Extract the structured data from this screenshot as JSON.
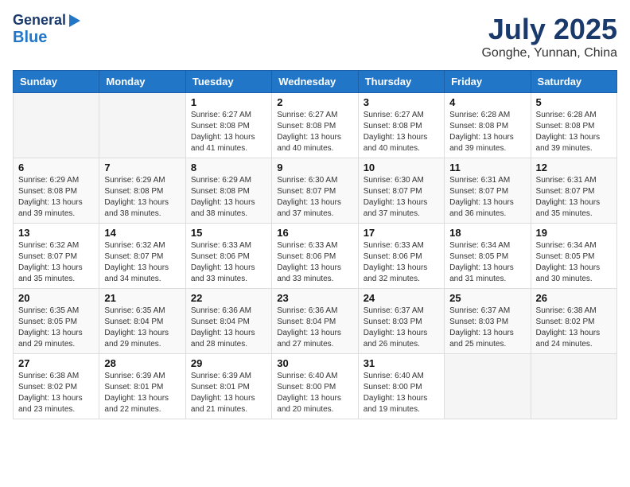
{
  "header": {
    "logo_line1": "General",
    "logo_line2": "Blue",
    "month": "July 2025",
    "location": "Gonghe, Yunnan, China"
  },
  "weekdays": [
    "Sunday",
    "Monday",
    "Tuesday",
    "Wednesday",
    "Thursday",
    "Friday",
    "Saturday"
  ],
  "weeks": [
    [
      {
        "day": "",
        "detail": ""
      },
      {
        "day": "",
        "detail": ""
      },
      {
        "day": "1",
        "detail": "Sunrise: 6:27 AM\nSunset: 8:08 PM\nDaylight: 13 hours and 41 minutes."
      },
      {
        "day": "2",
        "detail": "Sunrise: 6:27 AM\nSunset: 8:08 PM\nDaylight: 13 hours and 40 minutes."
      },
      {
        "day": "3",
        "detail": "Sunrise: 6:27 AM\nSunset: 8:08 PM\nDaylight: 13 hours and 40 minutes."
      },
      {
        "day": "4",
        "detail": "Sunrise: 6:28 AM\nSunset: 8:08 PM\nDaylight: 13 hours and 39 minutes."
      },
      {
        "day": "5",
        "detail": "Sunrise: 6:28 AM\nSunset: 8:08 PM\nDaylight: 13 hours and 39 minutes."
      }
    ],
    [
      {
        "day": "6",
        "detail": "Sunrise: 6:29 AM\nSunset: 8:08 PM\nDaylight: 13 hours and 39 minutes."
      },
      {
        "day": "7",
        "detail": "Sunrise: 6:29 AM\nSunset: 8:08 PM\nDaylight: 13 hours and 38 minutes."
      },
      {
        "day": "8",
        "detail": "Sunrise: 6:29 AM\nSunset: 8:08 PM\nDaylight: 13 hours and 38 minutes."
      },
      {
        "day": "9",
        "detail": "Sunrise: 6:30 AM\nSunset: 8:07 PM\nDaylight: 13 hours and 37 minutes."
      },
      {
        "day": "10",
        "detail": "Sunrise: 6:30 AM\nSunset: 8:07 PM\nDaylight: 13 hours and 37 minutes."
      },
      {
        "day": "11",
        "detail": "Sunrise: 6:31 AM\nSunset: 8:07 PM\nDaylight: 13 hours and 36 minutes."
      },
      {
        "day": "12",
        "detail": "Sunrise: 6:31 AM\nSunset: 8:07 PM\nDaylight: 13 hours and 35 minutes."
      }
    ],
    [
      {
        "day": "13",
        "detail": "Sunrise: 6:32 AM\nSunset: 8:07 PM\nDaylight: 13 hours and 35 minutes."
      },
      {
        "day": "14",
        "detail": "Sunrise: 6:32 AM\nSunset: 8:07 PM\nDaylight: 13 hours and 34 minutes."
      },
      {
        "day": "15",
        "detail": "Sunrise: 6:33 AM\nSunset: 8:06 PM\nDaylight: 13 hours and 33 minutes."
      },
      {
        "day": "16",
        "detail": "Sunrise: 6:33 AM\nSunset: 8:06 PM\nDaylight: 13 hours and 33 minutes."
      },
      {
        "day": "17",
        "detail": "Sunrise: 6:33 AM\nSunset: 8:06 PM\nDaylight: 13 hours and 32 minutes."
      },
      {
        "day": "18",
        "detail": "Sunrise: 6:34 AM\nSunset: 8:05 PM\nDaylight: 13 hours and 31 minutes."
      },
      {
        "day": "19",
        "detail": "Sunrise: 6:34 AM\nSunset: 8:05 PM\nDaylight: 13 hours and 30 minutes."
      }
    ],
    [
      {
        "day": "20",
        "detail": "Sunrise: 6:35 AM\nSunset: 8:05 PM\nDaylight: 13 hours and 29 minutes."
      },
      {
        "day": "21",
        "detail": "Sunrise: 6:35 AM\nSunset: 8:04 PM\nDaylight: 13 hours and 29 minutes."
      },
      {
        "day": "22",
        "detail": "Sunrise: 6:36 AM\nSunset: 8:04 PM\nDaylight: 13 hours and 28 minutes."
      },
      {
        "day": "23",
        "detail": "Sunrise: 6:36 AM\nSunset: 8:04 PM\nDaylight: 13 hours and 27 minutes."
      },
      {
        "day": "24",
        "detail": "Sunrise: 6:37 AM\nSunset: 8:03 PM\nDaylight: 13 hours and 26 minutes."
      },
      {
        "day": "25",
        "detail": "Sunrise: 6:37 AM\nSunset: 8:03 PM\nDaylight: 13 hours and 25 minutes."
      },
      {
        "day": "26",
        "detail": "Sunrise: 6:38 AM\nSunset: 8:02 PM\nDaylight: 13 hours and 24 minutes."
      }
    ],
    [
      {
        "day": "27",
        "detail": "Sunrise: 6:38 AM\nSunset: 8:02 PM\nDaylight: 13 hours and 23 minutes."
      },
      {
        "day": "28",
        "detail": "Sunrise: 6:39 AM\nSunset: 8:01 PM\nDaylight: 13 hours and 22 minutes."
      },
      {
        "day": "29",
        "detail": "Sunrise: 6:39 AM\nSunset: 8:01 PM\nDaylight: 13 hours and 21 minutes."
      },
      {
        "day": "30",
        "detail": "Sunrise: 6:40 AM\nSunset: 8:00 PM\nDaylight: 13 hours and 20 minutes."
      },
      {
        "day": "31",
        "detail": "Sunrise: 6:40 AM\nSunset: 8:00 PM\nDaylight: 13 hours and 19 minutes."
      },
      {
        "day": "",
        "detail": ""
      },
      {
        "day": "",
        "detail": ""
      }
    ]
  ]
}
